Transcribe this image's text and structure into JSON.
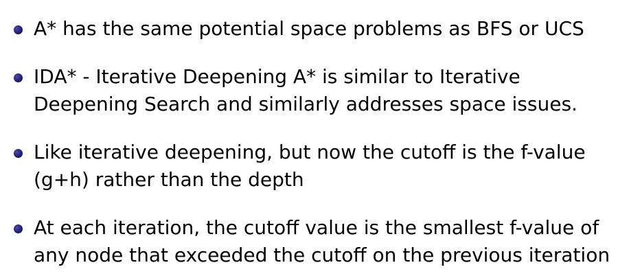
{
  "bullets": [
    {
      "lines": [
        "A* has the same potential space problems as BFS or UCS"
      ]
    },
    {
      "lines": [
        "IDA* - Iterative Deepening A* is similar to Iterative",
        "Deepening Search and similarly addresses space issues."
      ]
    },
    {
      "lines": [
        "Like iterative deepening, but now the cutoff is the f-value",
        "(g+h) rather than the depth"
      ]
    },
    {
      "lines": [
        "At each iteration, the cutoff value is the smallest f-value of",
        "any node that exceeded the cutoff on the previous iteration"
      ]
    }
  ],
  "colors": {
    "bullet": "#1f1f7a",
    "text": "#000000",
    "background": "#ffffff"
  }
}
